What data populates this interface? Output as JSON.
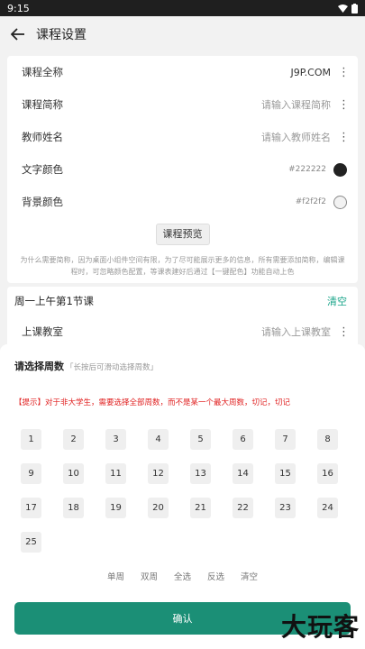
{
  "status": {
    "time": "9:15"
  },
  "appbar": {
    "title": "课程设置"
  },
  "form": {
    "full_name": {
      "label": "课程全称",
      "value": "J9P.COM"
    },
    "short_name": {
      "label": "课程简称",
      "placeholder": "请输入课程简称"
    },
    "teacher": {
      "label": "教师姓名",
      "placeholder": "请输入教师姓名"
    },
    "text_color": {
      "label": "文字颜色",
      "value": "#222222",
      "color": "#222222"
    },
    "bg_color": {
      "label": "背景颜色",
      "value": "#f2f2f2",
      "color": "#f2f2f2"
    },
    "preview_label": "课程预览",
    "hint": "为什么需要简称，因为桌面小组件空间有限，为了尽可能展示更多的信息，所有需要添加简称，编辑课程时，可忽略颜色配置，等课表建好后通过【一键配色】功能自动上色"
  },
  "lesson": {
    "title": "周一上午第1节课",
    "clear_label": "清空",
    "classroom": {
      "label": "上课教室",
      "placeholder": "请输入上课教室"
    }
  },
  "sheet": {
    "title": "请选择周数",
    "subtitle": "「长按后可滑动选择周数」",
    "tip": "【提示】对于非大学生，需要选择全部周数，而不是某一个最大周数，切记，切记",
    "weeks": [
      "1",
      "2",
      "3",
      "4",
      "5",
      "6",
      "7",
      "8",
      "9",
      "10",
      "11",
      "12",
      "13",
      "14",
      "15",
      "16",
      "17",
      "18",
      "19",
      "20",
      "21",
      "22",
      "23",
      "24",
      "25"
    ],
    "actions": [
      "单周",
      "双周",
      "全选",
      "反选",
      "清空"
    ],
    "confirm_label": "确认"
  },
  "watermark": "大玩客"
}
